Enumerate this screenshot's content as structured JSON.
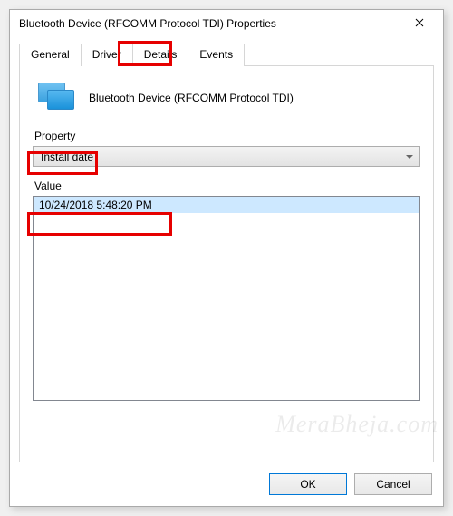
{
  "window": {
    "title": "Bluetooth Device (RFCOMM Protocol TDI) Properties"
  },
  "tabs": {
    "general": "General",
    "driver": "Driver",
    "details": "Details",
    "events": "Events",
    "active": "details"
  },
  "details": {
    "device_name": "Bluetooth Device (RFCOMM Protocol TDI)",
    "property_label": "Property",
    "property_selected": "Install date",
    "value_label": "Value",
    "value_items": [
      "10/24/2018 5:48:20 PM"
    ]
  },
  "buttons": {
    "ok": "OK",
    "cancel": "Cancel"
  },
  "watermark": "MeraBheja.com"
}
